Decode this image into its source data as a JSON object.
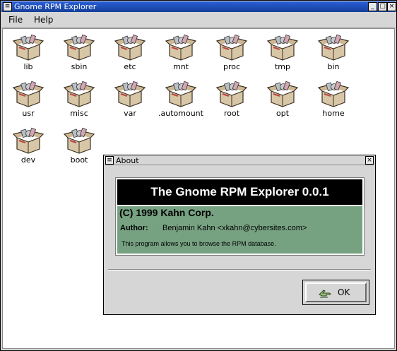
{
  "window": {
    "title": "Gnome RPM Explorer",
    "menu_glyph": "≡",
    "minimize_glyph": "_",
    "maximize_glyph": "□",
    "close_glyph": "×"
  },
  "menubar": {
    "file_label": "File",
    "help_label": "Help"
  },
  "icons": [
    {
      "label": "lib",
      "icon": "package-box-icon"
    },
    {
      "label": "sbin",
      "icon": "package-box-icon"
    },
    {
      "label": "etc",
      "icon": "package-box-icon"
    },
    {
      "label": "mnt",
      "icon": "package-box-icon"
    },
    {
      "label": "proc",
      "icon": "package-box-icon"
    },
    {
      "label": "tmp",
      "icon": "package-box-icon"
    },
    {
      "label": "bin",
      "icon": "package-box-icon"
    },
    {
      "label": "usr",
      "icon": "package-box-icon"
    },
    {
      "label": "misc",
      "icon": "package-box-icon"
    },
    {
      "label": "var",
      "icon": "package-box-icon"
    },
    {
      "label": ".automount",
      "icon": "package-box-icon"
    },
    {
      "label": "root",
      "icon": "package-box-icon"
    },
    {
      "label": "opt",
      "icon": "package-box-icon"
    },
    {
      "label": "home",
      "icon": "package-box-icon"
    },
    {
      "label": "dev",
      "icon": "package-box-icon"
    },
    {
      "label": "boot",
      "icon": "package-box-icon"
    }
  ],
  "about": {
    "title": "About",
    "menu_glyph": "≡",
    "close_glyph": "×",
    "header": "The Gnome RPM Explorer 0.0.1",
    "copyright": "(C) 1999 Kahn Corp.",
    "author_label": "Author:",
    "author_name": "Benjamin Kahn <xkahn@cybersites.com>",
    "description": "This program allows you to browse the RPM database.",
    "ok_label": "OK"
  },
  "colors": {
    "titlebar": "#2a5fd6",
    "about_green": "#76a282",
    "header_bg": "#000000"
  }
}
